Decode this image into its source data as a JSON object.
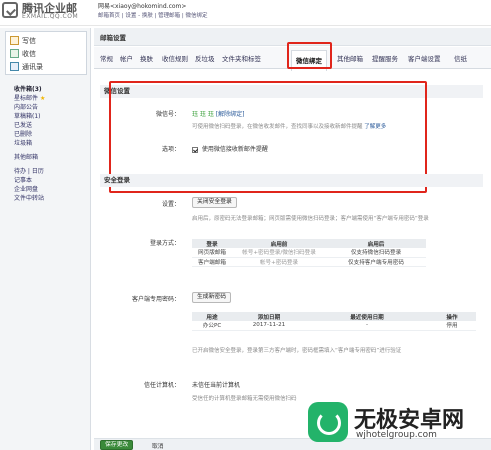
{
  "header": {
    "logo_name": "腾讯企业邮",
    "logo_domain": "EXMAIL.QQ.COM",
    "user_email": "网易<xiaoy@hokomind.com>",
    "user_links": "邮箱首页 | 设置 - 换肤 | 管理邮箱 | 微信绑定"
  },
  "sidebar": {
    "write": "写信",
    "receive": "收信",
    "contacts": "通讯录",
    "folders": [
      "收件箱(3)",
      "星标邮件",
      "内部公告",
      "草稿箱(1)",
      "已发送",
      "已删除",
      "垃圾箱"
    ],
    "other": "其他邮箱",
    "tools": [
      "待办 | 日历",
      "记事本",
      "企业网盘",
      "文件中转站"
    ]
  },
  "main": {
    "title": "邮箱设置",
    "tabs": [
      "常规",
      "帐户",
      "换肤",
      "收信规则",
      "反垃圾",
      "文件夹和标签",
      "微信绑定",
      "其他邮箱",
      "提醒服务",
      "客户端设置",
      "信纸"
    ],
    "active_tab": "微信绑定"
  },
  "wechat": {
    "section_title": "微信设置",
    "account_label": "微信号：",
    "account_value": "珏 珏 珏",
    "unbind_link": "[解除绑定]",
    "desc": "可使用微信扫码登录，在微信收发邮件，查找同事以及接收新邮件提醒",
    "learn_more": "了解更多",
    "option_label": "选项：",
    "option_text": "使用微信接收新邮件提醒"
  },
  "security": {
    "section_title": "安全登录",
    "setting_label": "设置：",
    "close_btn": "关闭安全登录",
    "setting_desc": "启用后，原密码无法登录邮箱；网页版需使用微信扫码登录；客户端需使用“客户端专用密码”登录",
    "login_method_label": "登录方式：",
    "login_table": {
      "headers": [
        "登录",
        "启用前",
        "启用后"
      ],
      "rows": [
        [
          "网页版邮箱",
          "帐号+密码登录/微信扫码登录",
          "仅支持微信扫码登录"
        ],
        [
          "客户端邮箱",
          "帐号+密码登录",
          "仅支持客户端专用密码"
        ]
      ]
    },
    "client_pwd_label": "客户端专用密码：",
    "generate_btn": "生成新密码",
    "pwd_table": {
      "headers": [
        "用途",
        "添加日期",
        "最近使用日期",
        "操作"
      ],
      "rows": [
        [
          "办公PC",
          "2017-11-21",
          "-",
          "停用"
        ]
      ]
    },
    "pwd_desc": "已开启微信安全登录，登录第三方客户端时，密码框需填入“客户端专用密码”进行验证",
    "trusted_label": "信任计算机：",
    "trusted_value": "未信任当前计算机",
    "trusted_desc": "受信任的计算机登录邮箱无需使用微信扫码"
  },
  "footer": {
    "save": "保存更改",
    "cancel": "取消"
  },
  "watermark": {
    "title": "无极安卓网",
    "url": "wjhotelgroup.com"
  }
}
